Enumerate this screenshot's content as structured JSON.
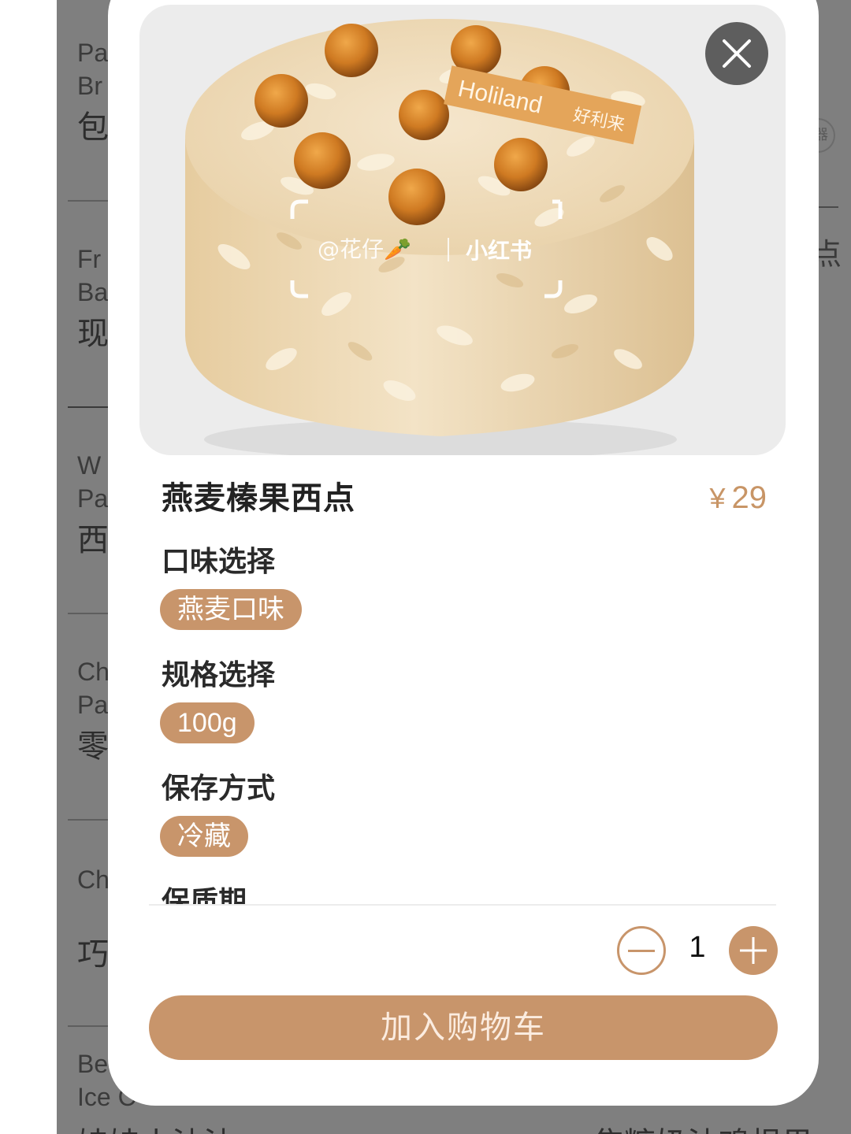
{
  "background": {
    "categories": [
      {
        "en1": "Pa",
        "en2": "Br",
        "zh": "包"
      },
      {
        "en1": "Fr",
        "en2": "Ba",
        "zh": "现"
      },
      {
        "en1": "W",
        "en2": "Pa",
        "zh": "西"
      },
      {
        "en1": "Ch",
        "en2": "Pa",
        "zh": "零"
      },
      {
        "en1": "Ch",
        "en2": "",
        "zh": "巧"
      },
      {
        "en1": "Be",
        "en2": "Ice C",
        "zh": ""
      }
    ],
    "right_text": "点",
    "right_badge": "器",
    "bottom_left": "娃娃小油油",
    "bottom_right": "焦糖奶油鸡根果"
  },
  "product": {
    "image_brand": "Holiland",
    "image_brand_cn": "好利来",
    "watermark_user": "@花仔🥕",
    "watermark_app": "小红书",
    "name": "燕麦榛果西点",
    "price_symbol": "¥",
    "price": "29"
  },
  "options": {
    "flavor": {
      "label": "口味选择",
      "value": "燕麦口味"
    },
    "size": {
      "label": "规格选择",
      "value": "100g"
    },
    "storage": {
      "label": "保存方式",
      "value": "冷藏"
    },
    "shelf_life": {
      "label": "保质期"
    }
  },
  "quantity": {
    "value": "1"
  },
  "actions": {
    "add_to_cart": "加入购物车"
  },
  "colors": {
    "accent": "#c8956b",
    "overlay": "#7f7f7f",
    "close_bg": "#5e5e5e"
  },
  "icons": {
    "close": "close-icon",
    "minus": "minus-icon",
    "plus": "plus-icon"
  }
}
